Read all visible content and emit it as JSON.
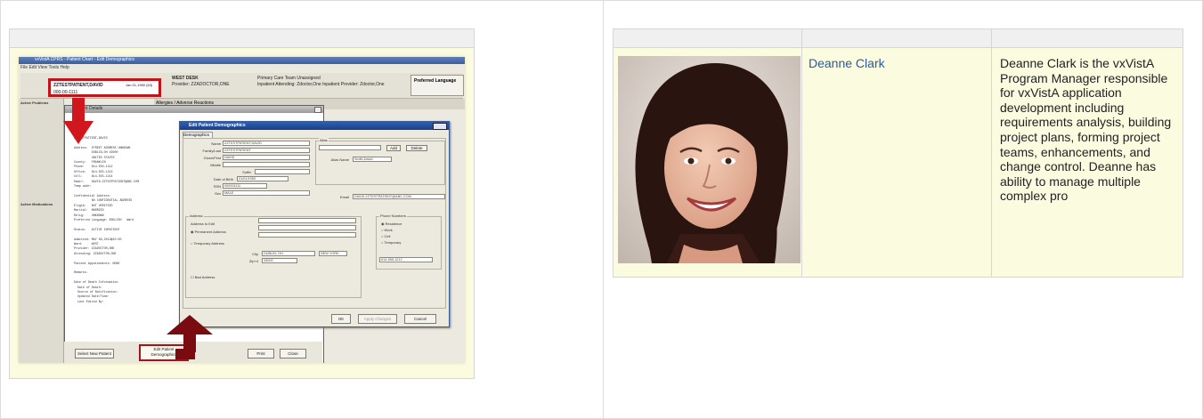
{
  "left_panel": {
    "screenshot_alt": "Edit Patient Demographics screenshot",
    "app": {
      "title": "vxVistA CPRS - Patient Chart - Edit Demographics",
      "menu": "File  Edit  View  Tools  Help",
      "patient_name": "ZZTESTPATIENT,DAVID",
      "patient_ssn": "000-00-1111",
      "patient_dob": "Jan 01,1950 (63)",
      "ward_line1": "WEST DESK",
      "ward_line2": "Provider: ZZADOCTOR,ONE",
      "care_line1": "Primary Care Team Unassigned",
      "care_line2": "Inpatient Attending: Zdoctor,One  Inpatient Provider: Zdoctor,One",
      "preferred_language": "Preferred Language",
      "left_items": [
        "Active Problems",
        "Active Medications"
      ],
      "allergies": "Allergies / Adverse Reactions",
      "details_title": "Patient Details",
      "details_text": "ZZTESTPATIENT,DAVID\n\nAddress:  STREET ADDRESS UNKNOWN\n          DUBLIN,OH 43000\n          UNITED STATES\nCounty:   FRANKLIN\nPhone:    614-555-1212\nOffice:   614-555-1213\nCell:     614-555-1214\nEmail:    DAVID.ZZTESTPATIENT@ABC.COM\nTemp addr:\n\nConfidential Address:\n          NO CONFIDENTIAL ADDRESS\nEligib:   NOT VERIFIED\nMarital:  MARRIED\nRelig:    UNKNOWN\nPreferred Language: ENGLISH   Ward\n\nStatus:   ACTIVE INPATIENT\n\nAdmitted: MAY 09,2013@10:00\nWard:     WEST\nProvider: ZZADOCTOR,ONE\nAttending: ZZADOCTOR,ONE\n\nPatient Appointments: NONE\n\nRemarks:\n\nDate of Death Information\n  Date of Death:\n  Source of Notification:\n  Updated Date/Time:\n  Last Edited By:",
      "buttons": {
        "select_new": "Select New Patient",
        "edit_demo_1": "Edit Patient",
        "edit_demo_2": "Demographics",
        "print": "Print",
        "close": "Close"
      },
      "dialog": {
        "title": "Edit Patient Demographics",
        "tab": "Demographics",
        "fields": [
          {
            "label": "Name",
            "value": "ZZTESTPATIENT,DAVID"
          },
          {
            "label": "Family/Last",
            "value": "ZZTESTPATIENT"
          },
          {
            "label": "Given/First",
            "value": "DAVID"
          },
          {
            "label": "Middle",
            "value": ""
          },
          {
            "label": "Suffix",
            "value": ""
          },
          {
            "label": "Date of Birth",
            "value": "01/01/1950"
          },
          {
            "label": "SSN",
            "value": "000001111"
          },
          {
            "label": "Sex",
            "value": "MALE"
          }
        ],
        "alias_group": "Alias",
        "alias_add": "Add",
        "alias_delete": "Delete",
        "alias_name_label": "Alias Name",
        "alias_name_value": "Smith,David",
        "email_label": "Email",
        "email_value": "DAVID.ZZTESTPATIENT@ABC.COM",
        "address_group": "Address",
        "address_to_edit": "Address to Edit",
        "permanent": "Permanent Address",
        "temporary": "Temporary Address",
        "city_label": "City",
        "city_value": "DUBLIN, OH",
        "zip_label": "Zip+4",
        "zip_value": "43000",
        "state_value": "NEW YORK",
        "bad_address": "Bad Address",
        "phone_group": "Phone Numbers",
        "phone_options": [
          "Residence",
          "Work",
          "Cell",
          "Temporary"
        ],
        "phone_value": "614-555-1212",
        "ok": "OK",
        "apply": "Apply Changes",
        "cancel": "Cancel"
      }
    }
  },
  "right_panel": {
    "photo_alt": "Deanne Clark photo",
    "name": "Deanne Clark",
    "bio": "Deanne Clark is the vxVistA Program Manager responsible for vxVistA application development including requirements analysis, building project plans, forming project teams, enhancements, and change control. Deanne has ability to manage multiple complex pro"
  },
  "colors": {
    "table_header": "#f0f0f0",
    "cell_background": "#fbfbe0",
    "link": "#2a59a4",
    "arrow_red": "#d0171e",
    "arrow_dark": "#7a0b10"
  }
}
